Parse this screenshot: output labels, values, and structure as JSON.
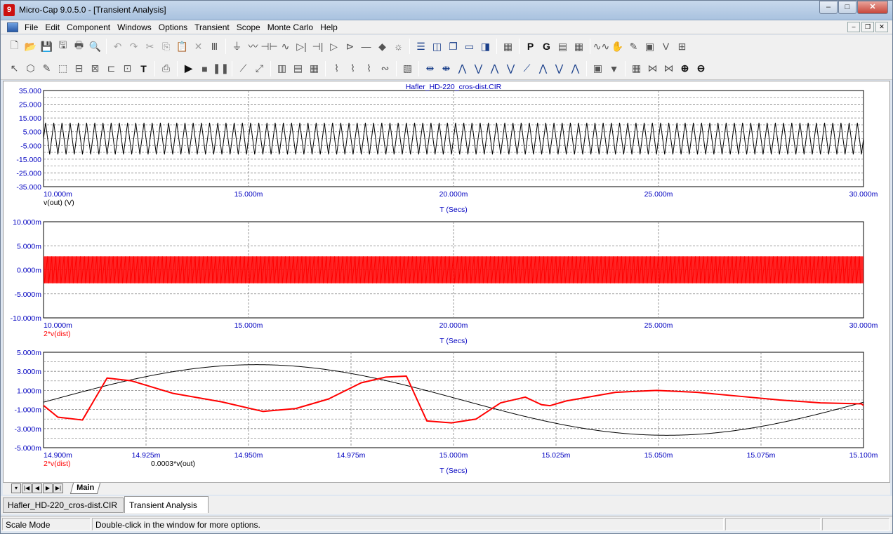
{
  "window": {
    "title": "Micro-Cap 9.0.5.0 - [Transient Analysis]",
    "app_icon_glyph": "9",
    "buttons": {
      "minimize": "–",
      "maximize": "□",
      "close": "✕"
    }
  },
  "menu": {
    "items": [
      "File",
      "Edit",
      "Component",
      "Windows",
      "Options",
      "Transient",
      "Scope",
      "Monte Carlo",
      "Help"
    ],
    "mdi_buttons": [
      "–",
      "❐",
      "✕"
    ]
  },
  "toolbar1": {
    "icons": [
      "new-icon",
      "open-icon",
      "save-icon",
      "save-all-icon",
      "print-icon",
      "print-preview-icon",
      "undo-icon",
      "redo-icon",
      "cut-icon",
      "copy-icon",
      "paste-icon",
      "delete-icon",
      "select-all-icon",
      "ground-icon",
      "resistor-icon",
      "capacitor-icon",
      "inductor-icon",
      "diode-icon",
      "battery-icon",
      "opamp-icon",
      "transistor-icon",
      "wire-icon",
      "junction-icon",
      "bulb-icon",
      "tile-horizontal-icon",
      "tile-vertical-icon",
      "cascade-icon",
      "window-icon",
      "split-icon",
      "calculator-icon",
      "p-icon",
      "g-icon",
      "grid-icon",
      "table-icon",
      "waveform-icon",
      "probe-icon",
      "pen-icon",
      "scope-icon",
      "values-icon",
      "zoom-window-icon"
    ],
    "glyphs": [
      "🗋",
      "📂",
      "💾",
      "🖫",
      "🖶",
      "🔍",
      "↶",
      "↷",
      "✂",
      "⎘",
      "📋",
      "✕",
      "Ⅲ",
      "⏚",
      "〰",
      "⊣⊢",
      "∿",
      "▷|",
      "⊣|",
      "▷",
      "⊳",
      "—",
      "◆",
      "☼",
      "☰",
      "◫",
      "❐",
      "▭",
      "◨",
      "▦",
      "P",
      "G",
      "▤",
      "▦",
      "∿∿",
      "✋",
      "✎",
      "▣",
      "V",
      "⊞"
    ]
  },
  "toolbar2": {
    "glyphs": [
      "↖",
      "⬡",
      "✎",
      "⬚",
      "⊟",
      "⊠",
      "⊏",
      "⊡",
      "T",
      "⎙",
      "▶",
      "■",
      "❚❚",
      "⟋",
      "⤢",
      "▥",
      "▤",
      "▦",
      "⌇",
      "⌇",
      "⌇",
      "∾",
      "▧",
      "⇹",
      "⇼",
      "⋀",
      "⋁",
      "⋀",
      "⋁",
      "⟋",
      "⋀",
      "⋁",
      "⋀",
      "▣",
      "▼",
      "▦",
      "⋈",
      "⋈",
      "⊕",
      "⊖"
    ]
  },
  "colors": {
    "axis_blue": "#0000c0",
    "red_trace": "#ff0000",
    "black_trace": "#000000",
    "grid": "#808080"
  },
  "plots": [
    {
      "title": "Hafler_HD-220_cros-dist.CIR",
      "y_ticks": [
        "35.000",
        "25.000",
        "15.000",
        "5.000",
        "-5.000",
        "-15.000",
        "-25.000",
        "-35.000"
      ],
      "x_ticks": [
        "10.000m",
        "15.000m",
        "20.000m",
        "25.000m",
        "30.000m"
      ],
      "xlabel": "T (Secs)",
      "legend": [
        "v(out) (V)"
      ]
    },
    {
      "y_ticks": [
        "10.000m",
        "5.000m",
        "0.000m",
        "-5.000m",
        "-10.000m"
      ],
      "x_ticks": [
        "10.000m",
        "15.000m",
        "20.000m",
        "25.000m",
        "30.000m"
      ],
      "xlabel": "T (Secs)",
      "legend": [
        "2*v(dist)"
      ]
    },
    {
      "y_ticks": [
        "5.000m",
        "3.000m",
        "1.000m",
        "-1.000m",
        "-3.000m",
        "-5.000m"
      ],
      "x_ticks": [
        "14.900m",
        "14.925m",
        "14.950m",
        "14.975m",
        "15.000m",
        "15.025m",
        "15.050m",
        "15.075m",
        "15.100m"
      ],
      "xlabel": "T (Secs)",
      "legend": [
        "2*v(dist)",
        "0.0003*v(out)"
      ]
    }
  ],
  "chart_data": [
    {
      "type": "line",
      "title": "Hafler_HD-220_cros-dist.CIR",
      "xlabel": "T (Secs)",
      "xlim": [
        0.01,
        0.03
      ],
      "ylim": [
        -35,
        35
      ],
      "grid": true,
      "series": [
        {
          "name": "v(out) (V)",
          "color": "#000000",
          "amplitude": 11.5,
          "frequency_hz": 5000
        }
      ]
    },
    {
      "type": "line",
      "xlabel": "T (Secs)",
      "xlim": [
        0.01,
        0.03
      ],
      "ylim": [
        -0.01,
        0.01
      ],
      "grid": true,
      "series": [
        {
          "name": "2*v(dist)",
          "color": "#ff0000",
          "max": 0.0028,
          "min": -0.0028
        }
      ]
    },
    {
      "type": "line",
      "xlabel": "T (Secs)",
      "xlim": [
        0.0149,
        0.0151
      ],
      "ylim": [
        -0.005,
        0.005
      ],
      "grid": true,
      "series": [
        {
          "name": "0.0003*v(out)",
          "color": "#000000",
          "amplitude": 0.0037,
          "frequency_hz": 5000
        },
        {
          "name": "2*v(dist)",
          "color": "#ff0000",
          "points_per_period": [
            [
              0.0,
              -0.0004
            ],
            [
              0.02,
              -0.0018
            ],
            [
              0.05,
              -0.0021
            ],
            [
              0.08,
              0.0023
            ],
            [
              0.11,
              0.002
            ],
            [
              0.16,
              0.0007
            ],
            [
              0.22,
              -0.0002
            ],
            [
              0.27,
              -0.0012
            ],
            [
              0.31,
              -0.0009
            ],
            [
              0.35,
              0.0001
            ],
            [
              0.39,
              0.0018
            ],
            [
              0.42,
              0.0024
            ],
            [
              0.445,
              0.0025
            ],
            [
              0.47,
              -0.0022
            ],
            [
              0.5,
              -0.0024
            ],
            [
              0.53,
              -0.002
            ],
            [
              0.56,
              -0.0003
            ],
            [
              0.59,
              0.0003
            ],
            [
              0.61,
              -0.0005
            ],
            [
              0.62,
              -0.0006
            ],
            [
              0.64,
              -0.0001
            ],
            [
              0.7,
              0.0008
            ],
            [
              0.75,
              0.001
            ],
            [
              0.8,
              0.0008
            ],
            [
              0.85,
              0.0004
            ],
            [
              0.9,
              0.0
            ],
            [
              0.95,
              -0.0003
            ],
            [
              1.0,
              -0.0004
            ]
          ]
        }
      ]
    }
  ],
  "tabs": {
    "sheet_nav": [
      "▾",
      "|◀",
      "◀",
      "▶",
      "▶|"
    ],
    "sheet": "Main",
    "documents": [
      "Hafler_HD-220_cros-dist.CIR",
      "Transient Analysis"
    ]
  },
  "status": {
    "mode": "Scale Mode",
    "hint": "Double-click in the window for more options."
  }
}
